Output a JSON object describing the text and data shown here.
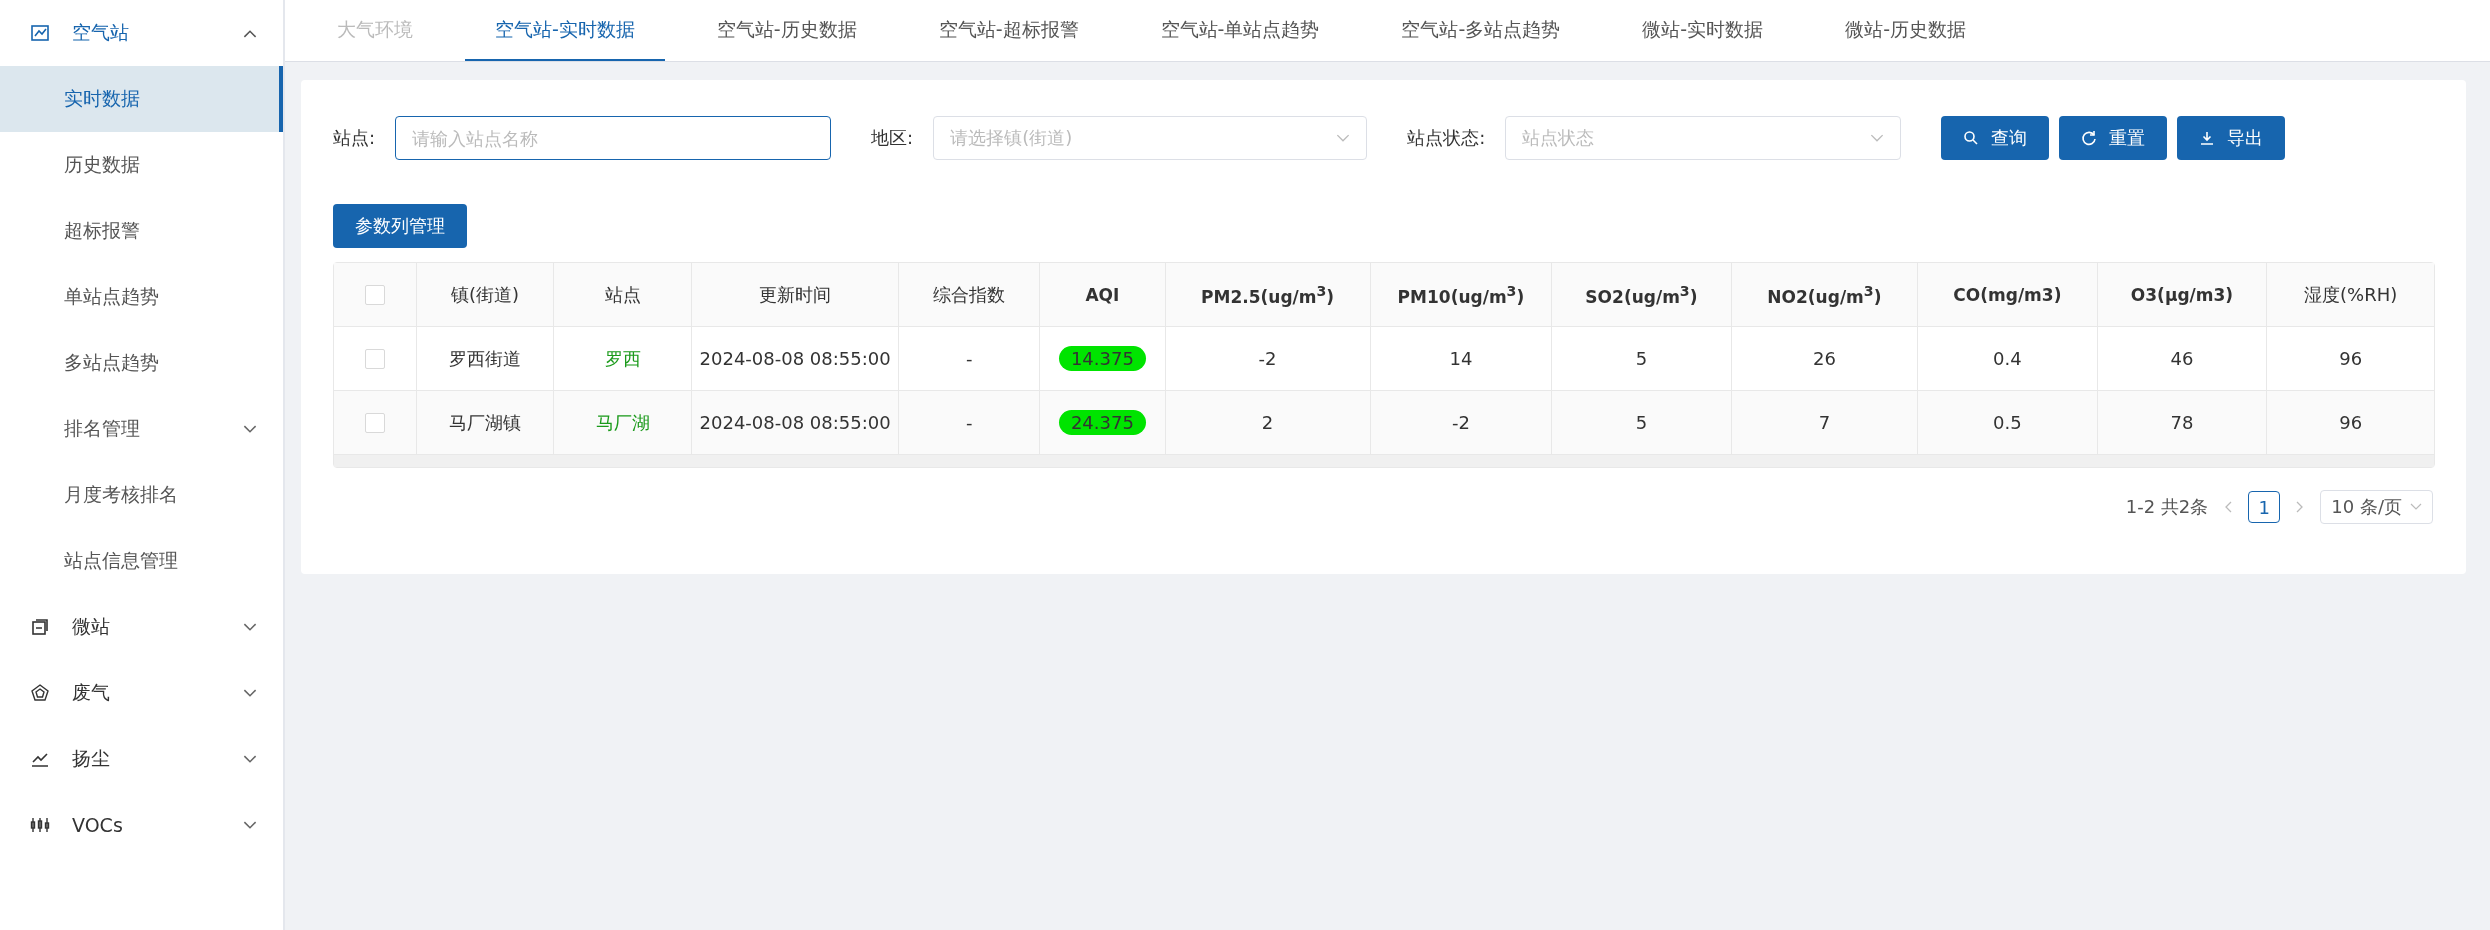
{
  "sidebar": {
    "items": [
      {
        "label": "空气站",
        "expanded": true,
        "selected": false,
        "children": [
          {
            "label": "实时数据",
            "selected": true
          },
          {
            "label": "历史数据",
            "selected": false
          },
          {
            "label": "超标报警",
            "selected": false
          },
          {
            "label": "单站点趋势",
            "selected": false
          },
          {
            "label": "多站点趋势",
            "selected": false
          },
          {
            "label": "排名管理",
            "selected": false,
            "expanded": false
          },
          {
            "label": "月度考核排名",
            "selected": false
          },
          {
            "label": "站点信息管理",
            "selected": false
          }
        ]
      },
      {
        "label": "微站",
        "expanded": false,
        "selected": false
      },
      {
        "label": "废气",
        "expanded": false,
        "selected": false
      },
      {
        "label": "扬尘",
        "expanded": false,
        "selected": false
      },
      {
        "label": "VOCs",
        "expanded": false,
        "selected": false
      }
    ]
  },
  "tabs": [
    {
      "label": "大气环境",
      "selected": false,
      "disabled": true
    },
    {
      "label": "空气站-实时数据",
      "selected": true,
      "disabled": false
    },
    {
      "label": "空气站-历史数据",
      "selected": false,
      "disabled": false
    },
    {
      "label": "空气站-超标报警",
      "selected": false,
      "disabled": false
    },
    {
      "label": "空气站-单站点趋势",
      "selected": false,
      "disabled": false
    },
    {
      "label": "空气站-多站点趋势",
      "selected": false,
      "disabled": false
    },
    {
      "label": "微站-实时数据",
      "selected": false,
      "disabled": false
    },
    {
      "label": "微站-历史数据",
      "selected": false,
      "disabled": false
    }
  ],
  "filters": [
    {
      "kind": "input",
      "label": "站点:",
      "placeholder": "请输入站点名称"
    },
    {
      "kind": "select",
      "label": "地区:",
      "placeholder": "请选择镇(街道)"
    },
    {
      "kind": "select",
      "label": "站点状态:",
      "placeholder": "站点状态"
    }
  ],
  "buttons": [
    {
      "label": "查询"
    },
    {
      "label": "重置"
    },
    {
      "label": "导出"
    }
  ],
  "column_button": "参数列管理",
  "table": {
    "select_all_checked": false,
    "columns": [
      "镇(街道)",
      "站点",
      "更新时间",
      "综合指数",
      "AQI",
      "PM2.5(ug/m$^{3}$)",
      "PM10(ug/m$^{3}$)",
      "SO2(ug/m$^{3}$)",
      "NO2(ug/m$^{3}$)",
      "CO(mg/m3)",
      "O3(μg/m3)",
      "湿度(%RH)"
    ],
    "rows": [
      {
        "checked": false,
        "cells": [
          "罗西街道",
          "罗西",
          "2024-08-08 08:55:00",
          "-",
          {
            "text": "14.375",
            "color": "#00e400"
          },
          "-2",
          "14",
          "5",
          "26",
          "0.4",
          "46",
          "96"
        ]
      },
      {
        "checked": false,
        "cells": [
          "马厂湖镇",
          "马厂湖",
          "2024-08-08 08:55:00",
          "-",
          {
            "text": "24.375",
            "color": "#00e400"
          },
          "2",
          "-2",
          "5",
          "7",
          "0.5",
          "78",
          "96"
        ]
      }
    ]
  },
  "pagination": {
    "summary": "1-2 共2条",
    "pages": [
      {
        "label": "1",
        "selected": true
      }
    ],
    "page_size": "10 条/页"
  }
}
